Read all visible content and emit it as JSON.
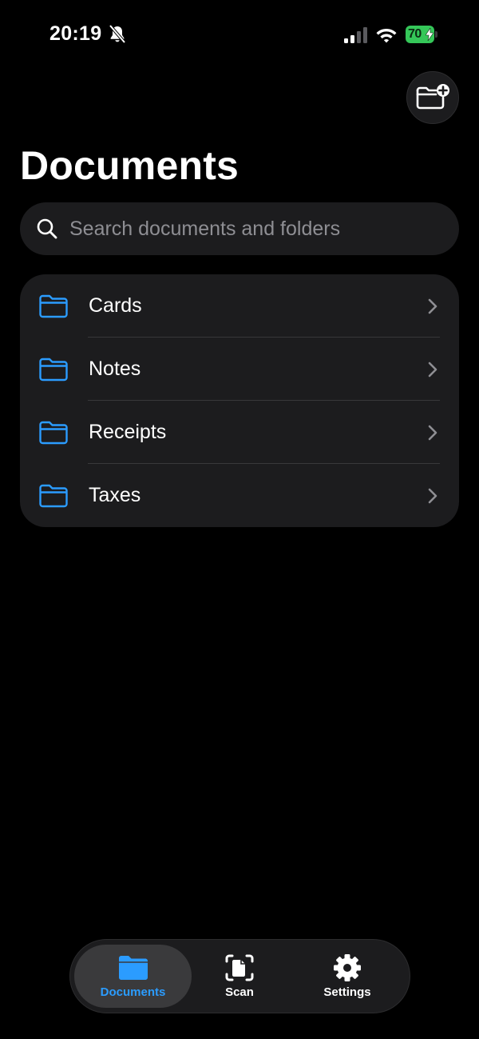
{
  "status_bar": {
    "time": "20:19",
    "battery_level": "70",
    "icons": [
      "bell-slash-icon",
      "cellular-signal-icon",
      "wifi-icon",
      "battery-icon",
      "bolt-icon"
    ]
  },
  "header": {
    "title": "Documents",
    "new_folder_icon": "folder-plus-icon"
  },
  "search": {
    "placeholder": "Search documents and folders",
    "value": ""
  },
  "folders": [
    {
      "label": "Cards"
    },
    {
      "label": "Notes"
    },
    {
      "label": "Receipts"
    },
    {
      "label": "Taxes"
    }
  ],
  "tab_bar": {
    "selected": "Documents",
    "tabs": [
      {
        "label": "Documents",
        "icon": "folder-icon"
      },
      {
        "label": "Scan",
        "icon": "scan-document-icon"
      },
      {
        "label": "Settings",
        "icon": "gear-icon"
      }
    ]
  },
  "colors": {
    "background": "#000000",
    "card": "#1c1c1e",
    "accent": "#2b9cff",
    "battery": "#35c759",
    "secondary_text": "#8e8e93"
  }
}
